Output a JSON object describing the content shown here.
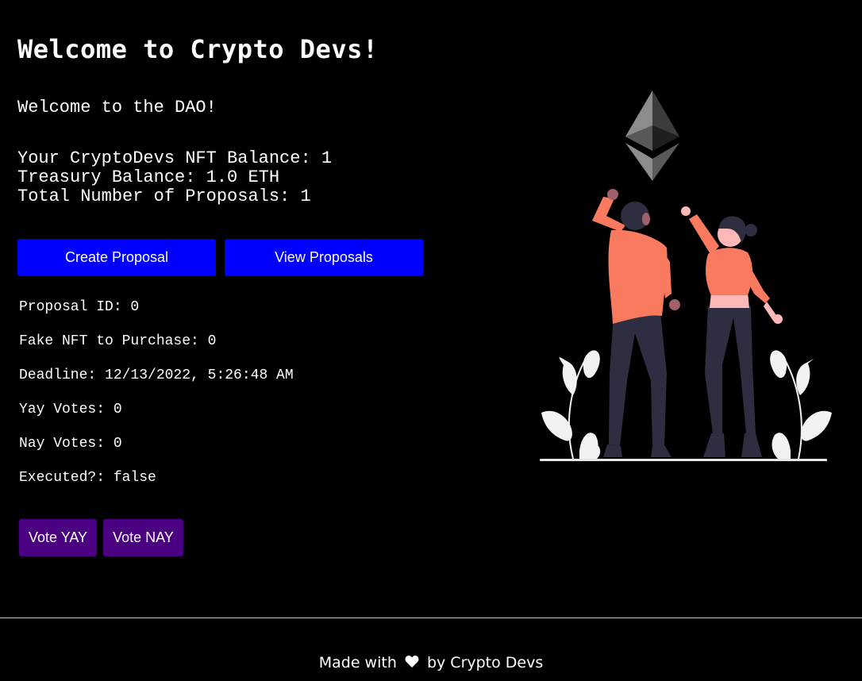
{
  "header": {
    "title": "Welcome to Crypto Devs!"
  },
  "intro": {
    "welcome": "Welcome to the DAO!",
    "nft_balance": "Your CryptoDevs NFT Balance: 1",
    "treasury_balance": "Treasury Balance: 1.0 ETH",
    "total_proposals": "Total Number of Proposals: 1"
  },
  "actions": {
    "create_label": "Create Proposal",
    "view_label": "View Proposals"
  },
  "proposal": {
    "id": "Proposal ID: 0",
    "nft": "Fake NFT to Purchase: 0",
    "deadline": "Deadline: 12/13/2022, 5:26:48 AM",
    "yay": "Yay Votes: 0",
    "nay": "Nay Votes: 0",
    "executed": "Executed?: false"
  },
  "vote": {
    "yay_label": "Vote YAY",
    "nay_label": "Vote NAY"
  },
  "footer": {
    "prefix": "Made with",
    "heart_icon": "heart-icon",
    "suffix": "by Crypto Devs"
  },
  "colors": {
    "background": "#000000",
    "primary_button": "#0000ff",
    "vote_button": "#4b0082",
    "figure_shirt": "#fa7a5f",
    "figure_pants": "#2f2e41"
  }
}
